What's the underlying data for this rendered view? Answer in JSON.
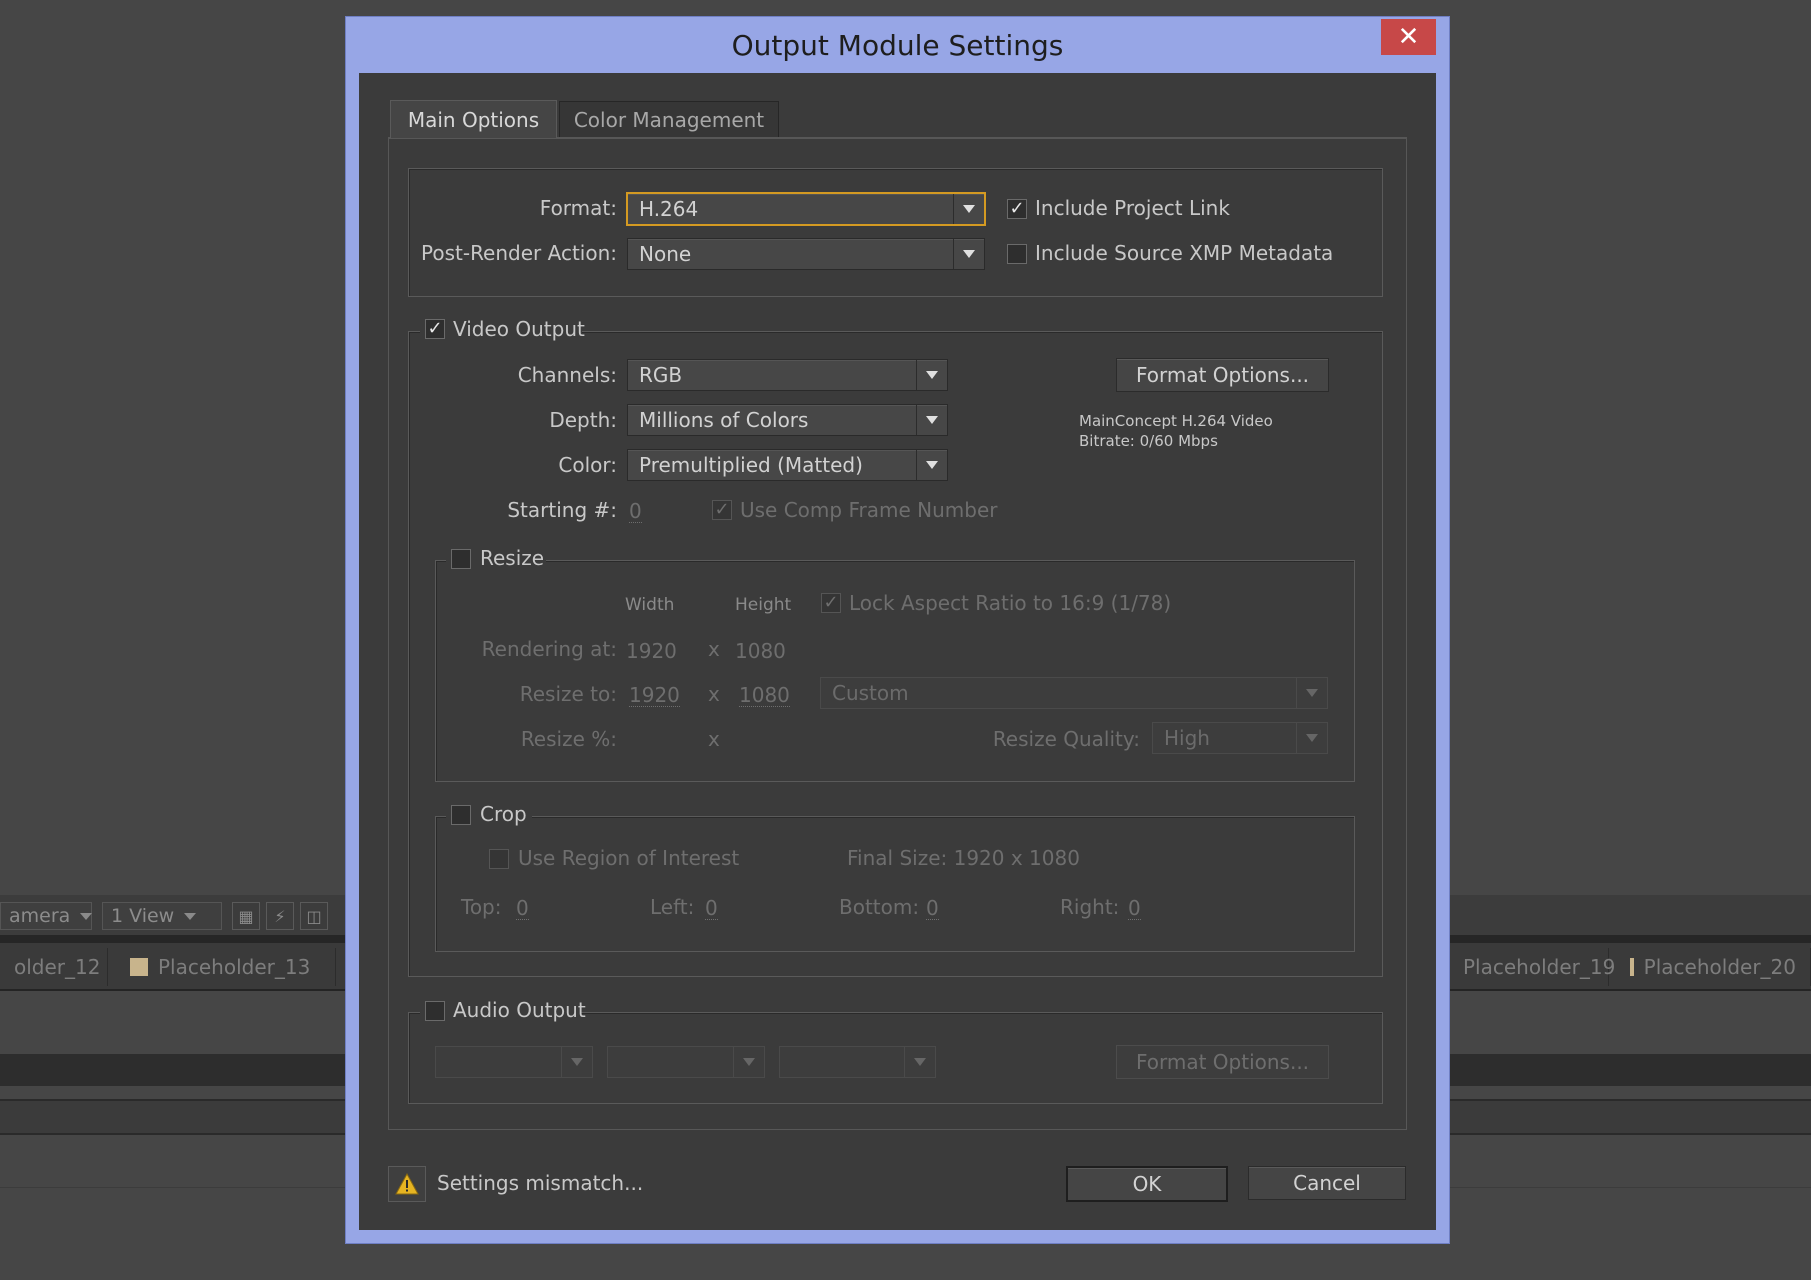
{
  "background": {
    "camera_label": "amera",
    "view_label": "1 View",
    "tabs": [
      "older_12",
      "Placeholder_13",
      "Placeholder_19",
      "Placeholder_20"
    ]
  },
  "dialog": {
    "title": "Output Module Settings",
    "close_label": "✕",
    "tabs": [
      {
        "label": "Main Options",
        "active": true
      },
      {
        "label": "Color Management",
        "active": false
      }
    ],
    "format_label": "Format:",
    "format_value": "H.264",
    "post_render_label": "Post-Render Action:",
    "post_render_value": "None",
    "include_project_link": {
      "label": "Include Project Link",
      "checked": true
    },
    "include_xmp": {
      "label": "Include Source XMP Metadata",
      "checked": false
    },
    "video_output": {
      "label": "Video Output",
      "checked": true,
      "channels_label": "Channels:",
      "channels_value": "RGB",
      "depth_label": "Depth:",
      "depth_value": "Millions of Colors",
      "color_label": "Color:",
      "color_value": "Premultiplied (Matted)",
      "starting_label": "Starting #:",
      "starting_value": "0",
      "use_comp_frame_label": "Use Comp Frame Number",
      "format_options_label": "Format Options...",
      "codec_info_line1": "MainConcept H.264 Video",
      "codec_info_line2": "Bitrate: 0/60 Mbps"
    },
    "resize": {
      "label": "Resize",
      "checked": false,
      "width_header": "Width",
      "height_header": "Height",
      "lock_aspect_label": "Lock Aspect Ratio to 16:9 (1/78)",
      "rendering_at_label": "Rendering at:",
      "rendering_width": "1920",
      "rendering_height": "1080",
      "times": "x",
      "resize_to_label": "Resize to:",
      "resize_width": "1920",
      "resize_height": "1080",
      "preset_value": "Custom",
      "resize_pct_label": "Resize %:",
      "quality_label": "Resize Quality:",
      "quality_value": "High"
    },
    "crop": {
      "label": "Crop",
      "checked": false,
      "use_roi_label": "Use Region of Interest",
      "final_size": "Final Size: 1920 x 1080",
      "top_label": "Top:",
      "top_value": "0",
      "left_label": "Left:",
      "left_value": "0",
      "bottom_label": "Bottom:",
      "bottom_value": "0",
      "right_label": "Right:",
      "right_value": "0"
    },
    "audio_output": {
      "label": "Audio Output",
      "checked": false,
      "format_options_label": "Format Options..."
    },
    "warning_text": "Settings mismatch...",
    "ok_label": "OK",
    "cancel_label": "Cancel",
    "accent_color": "#d49a22",
    "title_bar_color": "#97a6e6"
  }
}
